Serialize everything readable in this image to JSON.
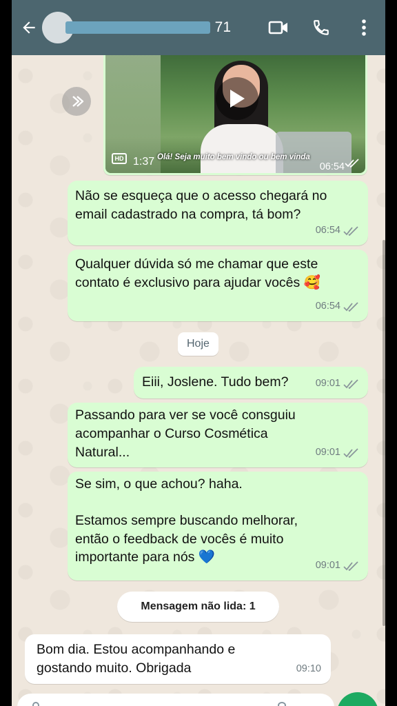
{
  "header": {
    "contact_suffix": "71"
  },
  "video_message": {
    "hd_badge": "HD",
    "duration": "1:37",
    "caption": "Olá! Seja muito bem vindo ou bem vinda",
    "time": "06:54"
  },
  "messages": [
    {
      "text": "Não se esqueça que o acesso chegará no\nemail cadastrado na compra, tá bom?",
      "time": "06:54"
    },
    {
      "text": "Qualquer dúvida só me chamar que este\ncontato é exclusivo para ajudar vocês 🥰",
      "time": "06:54"
    },
    {
      "text": "Eiii, Joslene. Tudo bem?",
      "time": "09:01"
    },
    {
      "text": "Passando para ver se você consguiu\nacompanhar o Curso Cosmética\nNatural...",
      "time": "09:01"
    },
    {
      "text": "Se sim, o que achou? haha.\n\nEstamos sempre buscando melhorar,\nentão o feedback de vocês é muito\nimportante para nós 💙",
      "time": "09:01"
    }
  ],
  "date_divider": "Hoje",
  "unread_divider": "Mensagem não lida: 1",
  "incoming": {
    "text": "Bom dia. Estou acompanhando e\ngostando muito. Obrigada",
    "time": "09:10"
  },
  "colors": {
    "appbar": "#4c666f",
    "outgoing_bubble": "#d9fdd3",
    "incoming_bubble": "#ffffff",
    "chat_background": "#efe7dd",
    "read_ticks": "#8a969b"
  },
  "icons": [
    "back-arrow-icon",
    "video-call-icon",
    "phone-icon",
    "more-options-icon",
    "play-icon",
    "forward-icon",
    "double-check-icon",
    "mic-icon"
  ]
}
